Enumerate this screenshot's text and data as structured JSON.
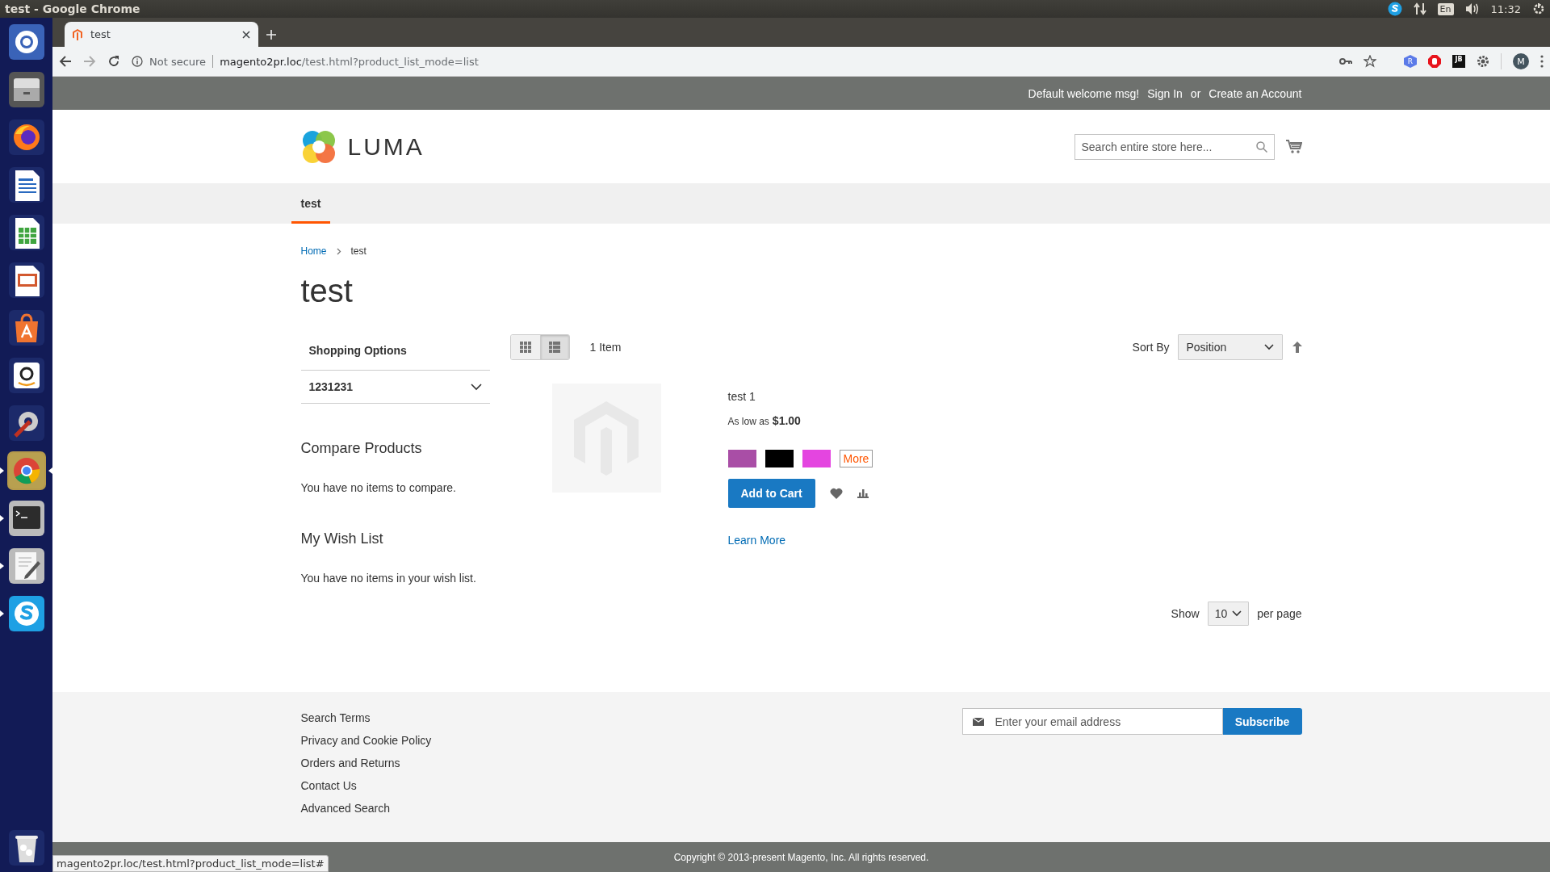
{
  "system_bar": {
    "title": "test - Google Chrome",
    "keyboard_layout": "En",
    "time": "11:32"
  },
  "launcher": [
    {
      "kind": "ubuntu",
      "running": false,
      "selected": false
    },
    {
      "kind": "files",
      "running": false,
      "selected": false
    },
    {
      "kind": "firefox",
      "running": false,
      "selected": false
    },
    {
      "kind": "writer",
      "running": false,
      "selected": false
    },
    {
      "kind": "calc",
      "running": false,
      "selected": false
    },
    {
      "kind": "impress",
      "running": false,
      "selected": false
    },
    {
      "kind": "software",
      "running": false,
      "selected": false
    },
    {
      "kind": "amazon",
      "running": false,
      "selected": false
    },
    {
      "kind": "settings",
      "running": false,
      "selected": false
    },
    {
      "kind": "chrome",
      "running": true,
      "selected": true
    },
    {
      "kind": "terminal",
      "running": true,
      "selected": false
    },
    {
      "kind": "editor",
      "running": true,
      "selected": false
    },
    {
      "kind": "skype",
      "running": true,
      "selected": false
    },
    {
      "kind": "trash",
      "running": false,
      "selected": false
    }
  ],
  "browser": {
    "tabs": [
      {
        "title": "test",
        "selected": true
      }
    ],
    "address": {
      "security": "Not secure",
      "host": "magento2pr.loc",
      "path": "/test.html?product_list_mode=list"
    },
    "extensions": [
      {
        "kind": "hexagon",
        "label": "R"
      },
      {
        "kind": "stop"
      },
      {
        "kind": "box",
        "label": "JB"
      },
      {
        "kind": "gear"
      }
    ],
    "profile": "M",
    "status_url": "magento2pr.loc/test.html?product_list_mode=list#"
  },
  "page": {
    "panel": {
      "welcome": "Default welcome msg!",
      "sign_in": "Sign In",
      "or": "or",
      "create_account": "Create an Account"
    },
    "logo": "LUMA",
    "search": {
      "placeholder": "Search entire store here..."
    },
    "nav": [
      {
        "label": "test",
        "selected": true
      }
    ],
    "breadcrumbs": [
      "Home",
      "test"
    ],
    "title": "test",
    "sidebar": {
      "filter_title": "Shopping Options",
      "filter": {
        "label": "1231231",
        "expanded": false
      },
      "compare_title": "Compare Products",
      "compare_text": "You have no items to compare.",
      "wishlist_title": "My Wish List",
      "wishlist_text": "You have no items in your wish list."
    },
    "toolbar": {
      "modes": [
        {
          "kind": "grid",
          "selected": false
        },
        {
          "kind": "list",
          "selected": true
        }
      ],
      "amount": "1 Item",
      "sort_label": "Sort By",
      "sort_value": "Position"
    },
    "product": {
      "name": "test 1",
      "price_label": "As low as",
      "price": "$1.00",
      "swatches": [
        {
          "color": "#a94ea6"
        },
        {
          "color": "#000000"
        },
        {
          "color": "#e445e0"
        }
      ],
      "more": "More",
      "add_to_cart": "Add to Cart",
      "learn_more": "Learn More"
    },
    "limiter": {
      "label": "Show",
      "value": "10",
      "suffix": "per page"
    },
    "footer": {
      "links": [
        "Search Terms",
        "Privacy and Cookie Policy",
        "Orders and Returns",
        "Contact Us",
        "Advanced Search"
      ],
      "newsletter_placeholder": "Enter your email address",
      "subscribe": "Subscribe"
    },
    "copyright": "Copyright © 2013-present Magento, Inc. All rights reserved."
  }
}
